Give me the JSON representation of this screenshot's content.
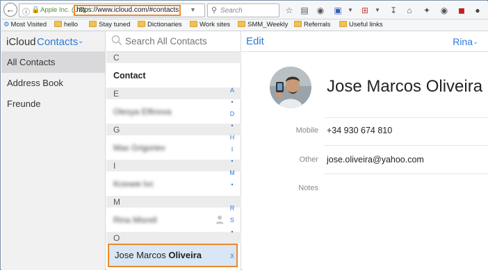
{
  "browser": {
    "site_identity": "Apple Inc. (US)",
    "url": "https://www.icloud.com/#contacts",
    "search_placeholder": "Search",
    "bookmarks": [
      {
        "label": "Most Visited",
        "icon": "gear-icon"
      },
      {
        "label": "hello",
        "icon": "folder-icon"
      },
      {
        "label": "Stay tuned",
        "icon": "folder-icon"
      },
      {
        "label": "Dictionaries",
        "icon": "folder-icon"
      },
      {
        "label": "Work sites",
        "icon": "folder-icon"
      },
      {
        "label": "SMM_Weekly",
        "icon": "folder-icon"
      },
      {
        "label": "Referrals",
        "icon": "folder-icon"
      },
      {
        "label": "Useful links",
        "icon": "folder-icon"
      }
    ]
  },
  "sidebar": {
    "brand": "iCloud",
    "app": "Contacts",
    "items": [
      {
        "label": "All Contacts",
        "active": true
      },
      {
        "label": "Address Book",
        "active": false
      },
      {
        "label": "Freunde",
        "active": false
      }
    ]
  },
  "list": {
    "search_placeholder": "Search All Contacts",
    "sections": [
      {
        "letter": "C",
        "rows": [
          {
            "label": "Contact",
            "style": "bold"
          }
        ]
      },
      {
        "letter": "E",
        "rows": [
          {
            "label": "Olesya Elfinova",
            "style": "blurred"
          }
        ]
      },
      {
        "letter": "G",
        "rows": [
          {
            "label": "Max Grigoriev",
            "style": "blurred"
          }
        ]
      },
      {
        "letter": "I",
        "rows": [
          {
            "label": "Ксения Ivc",
            "style": "blurred"
          }
        ]
      },
      {
        "letter": "M",
        "rows": [
          {
            "label": "Rina Misrell",
            "style": "blurred"
          }
        ]
      },
      {
        "letter": "O",
        "rows": [
          {
            "first": "Jose Marcos",
            "last": "Oliveira",
            "style": "selected"
          }
        ]
      }
    ],
    "index_letters": [
      "A",
      "•",
      "D",
      "•",
      "H",
      "I",
      "•",
      "M",
      "•",
      "R",
      "S",
      "•",
      "X"
    ]
  },
  "detail": {
    "edit_label": "Edit",
    "user_label": "Rina",
    "name": "Jose Marcos Oliveira",
    "fields": [
      {
        "label": "Mobile",
        "value": "+34 930 674 810"
      },
      {
        "label": "Other",
        "value": "jose.oliveira@yahoo.com"
      },
      {
        "label": "Notes",
        "value": ""
      }
    ]
  },
  "colors": {
    "accent": "#2b7ad8",
    "highlight_border": "#e98a2c",
    "selected_row": "#d9e6f5",
    "sidebar_bg": "#f1f1f2"
  }
}
